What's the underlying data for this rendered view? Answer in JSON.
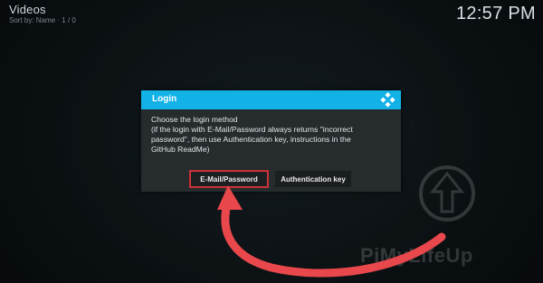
{
  "header": {
    "title": "Videos",
    "sort_label": "Sort by: Name",
    "position": "1 / 0",
    "clock": "12:57 PM"
  },
  "dialog": {
    "title": "Login",
    "lines": [
      "Choose the login method",
      "(if the login with E-Mail/Password always returns \"incorrect",
      "password\", then use Authentication key, instructions in the",
      "GitHub ReadMe)"
    ],
    "buttons": {
      "email_label": "E-Mail/Password",
      "auth_label": "Authentication key"
    }
  },
  "watermark": {
    "text": "PiMyLifeUp"
  },
  "colors": {
    "header_accent": "#12b2e7",
    "highlight": "#d8383e",
    "dialog_bg": "#262b2e"
  }
}
